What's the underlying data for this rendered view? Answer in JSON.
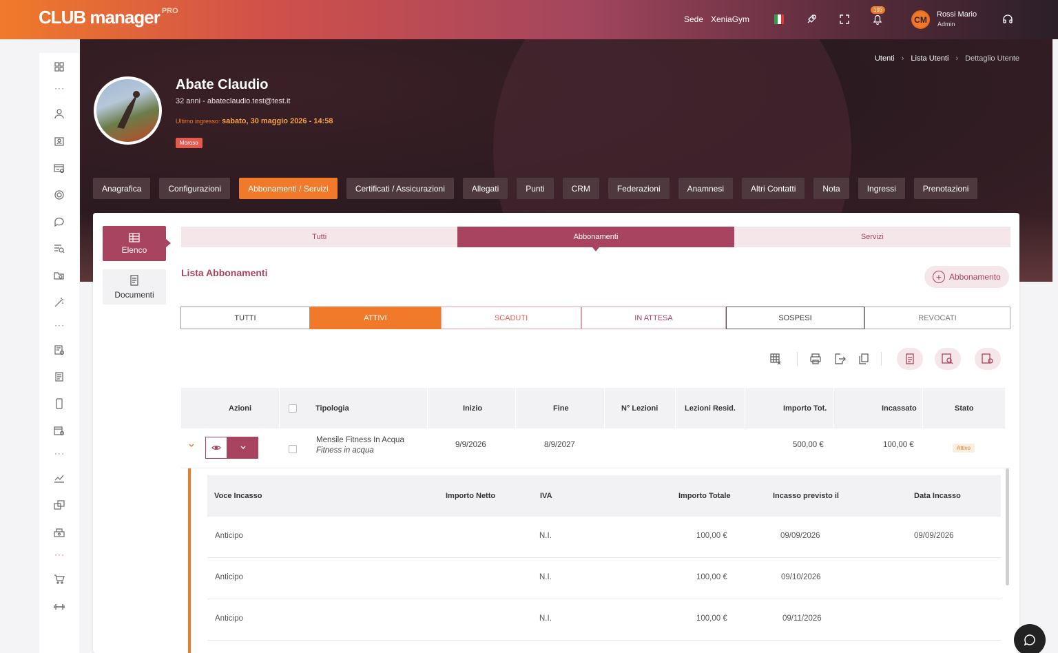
{
  "app": {
    "logo_main": "CLUB manager",
    "logo_pro": "PRO"
  },
  "topbar": {
    "sede_label": "Sede",
    "sede_value": "XeniaGym",
    "notifications_count": "193",
    "user_initials": "CM",
    "user_name": "Rossi Mario",
    "user_role": "Admin"
  },
  "breadcrumb": [
    "Utenti",
    "Lista Utenti",
    "Dettaglio Utente"
  ],
  "profile": {
    "name": "Abate Claudio",
    "subtitle": "32 anni - abateclaudio.test@test.it",
    "last_access_label": "Ultimo ingresso:",
    "last_access_value": "sabato, 30 maggio 2026 - 14:58",
    "status_badge": "Moroso"
  },
  "main_tabs": [
    "Anagrafica",
    "Configurazioni",
    "Abbonamenti / Servizi",
    "Certificati / Assicurazioni",
    "Allegati",
    "Punti",
    "CRM",
    "Federazioni",
    "Anamnesi",
    "Altri Contatti",
    "Nota",
    "Ingressi",
    "Prenotazioni"
  ],
  "active_main_tab": "Abbonamenti / Servizi",
  "side_tabs": {
    "elenco": "Elenco",
    "documenti": "Documenti"
  },
  "sub_tabs": [
    "Tutti",
    "Abbonamenti",
    "Servizi"
  ],
  "list": {
    "title": "Lista Abbonamenti",
    "add_label": "Abbonamento"
  },
  "filters": [
    "TUTTI",
    "ATTIVI",
    "SCADUTI",
    "IN ATTESA",
    "SOSPESI",
    "REVOCATI"
  ],
  "table": {
    "headers": [
      "Azioni",
      "Tipologia",
      "Inizio",
      "Fine",
      "N° Lezioni",
      "Lezioni Resid.",
      "Importo Tot.",
      "Incassato",
      "Stato"
    ],
    "row": {
      "tipologia": "Mensile Fitness In Acqua",
      "tipologia_sub": "Fitness in acqua",
      "inizio": "9/9/2026",
      "fine": "8/9/2027",
      "importo": "500,00 €",
      "incassato": "100,00 €",
      "stato": "Attivo"
    }
  },
  "detail": {
    "headers": [
      "Voce Incasso",
      "Importo Netto",
      "IVA",
      "Importo Totale",
      "Incasso previsto il",
      "Data Incasso"
    ],
    "rows": [
      {
        "voce": "Anticipo",
        "iva": "N.I.",
        "totale": "100,00 €",
        "previsto": "09/09/2026",
        "data": "09/09/2026"
      },
      {
        "voce": "Anticipo",
        "iva": "N.I.",
        "totale": "100,00 €",
        "previsto": "09/10/2026",
        "data": ""
      },
      {
        "voce": "Anticipo",
        "iva": "N.I.",
        "totale": "100,00 €",
        "previsto": "09/11/2026",
        "data": ""
      }
    ]
  },
  "colors": {
    "accent": "#f07a2a",
    "brand": "#a8445f",
    "dark": "#2b1f28"
  }
}
